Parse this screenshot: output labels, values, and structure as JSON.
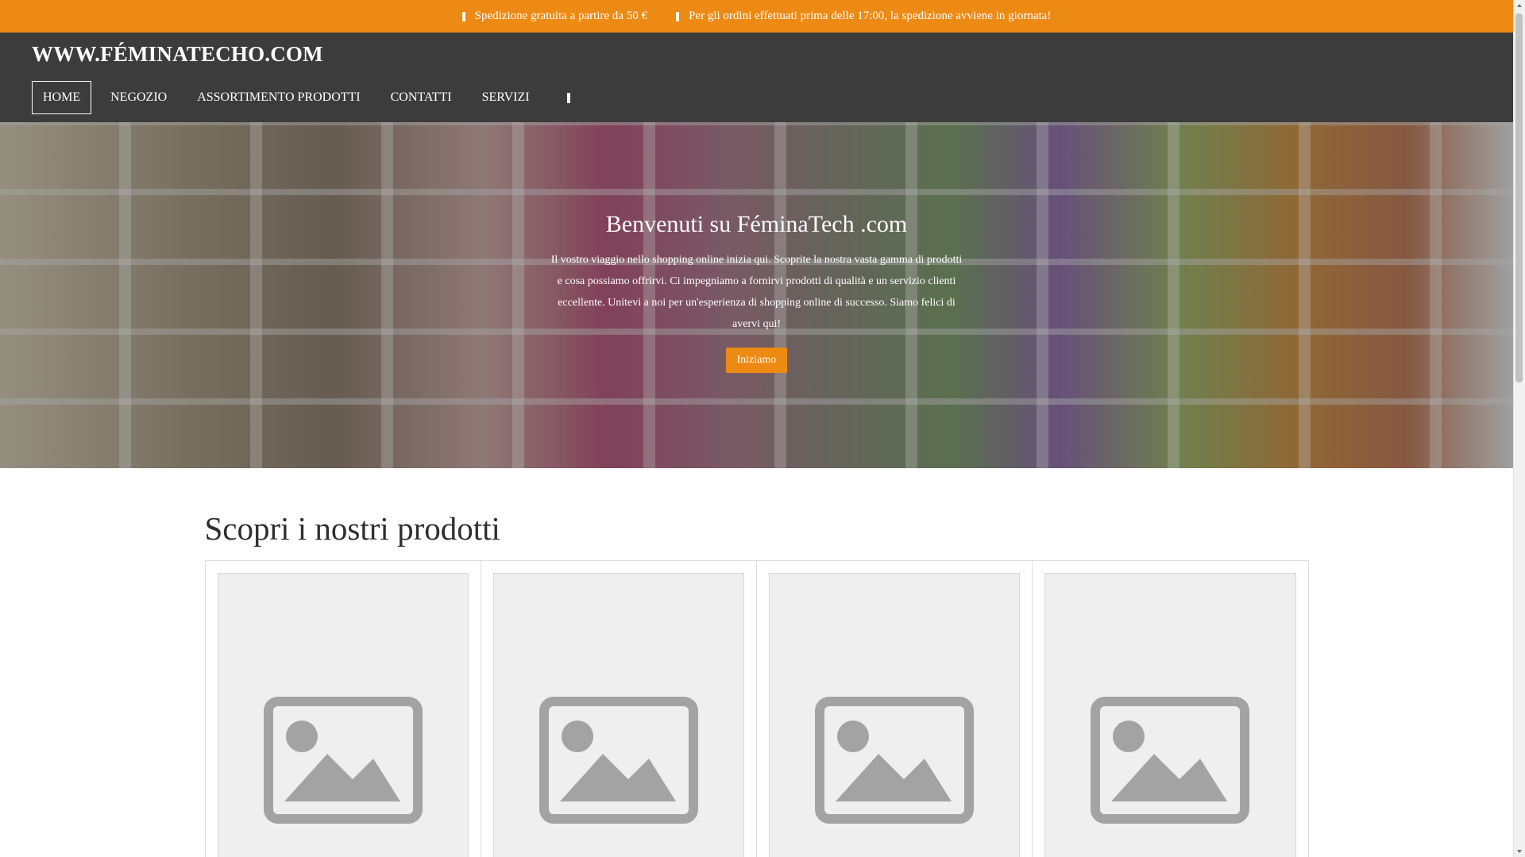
{
  "topbar": {
    "background": "#ec8a14",
    "items": [
      {
        "icon": "truck-icon",
        "text": "Spedizione gratuita a partire da 50 €"
      },
      {
        "icon": "clock-icon",
        "text": "Per gli ordini effettuati prima delle 17:00, la spedizione avviene in giornata!"
      }
    ]
  },
  "header": {
    "site_title": "WWW.FÉMINATECHO.COM",
    "nav": [
      {
        "label": "HOME",
        "active": true
      },
      {
        "label": "NEGOZIO",
        "active": false
      },
      {
        "label": "ASSORTIMENTO PRODOTTI",
        "active": false
      },
      {
        "label": "CONTATTI",
        "active": false
      },
      {
        "label": "SERVIZI",
        "active": false
      }
    ],
    "search_icon": "search-icon"
  },
  "hero": {
    "title": "Benvenuti su FéminaTech .com",
    "text": "Il vostro viaggio nello shopping online inizia qui. Scoprite la nostra vasta gamma di prodotti e cosa possiamo offrirvi. Ci impegniamo a fornirvi prodotti di qualità e un servizio clienti eccellente. Unitevi a noi per un'esperienza di shopping online di successo. Siamo felici di avervi qui!",
    "button_label": "Iniziamo",
    "button_color": "#ec8a14"
  },
  "products": {
    "title": "Scopri i nostri prodotti",
    "items": [
      {
        "image": "image-placeholder-icon"
      },
      {
        "image": "image-placeholder-icon"
      },
      {
        "image": "image-placeholder-icon"
      },
      {
        "image": "image-placeholder-icon"
      }
    ]
  }
}
